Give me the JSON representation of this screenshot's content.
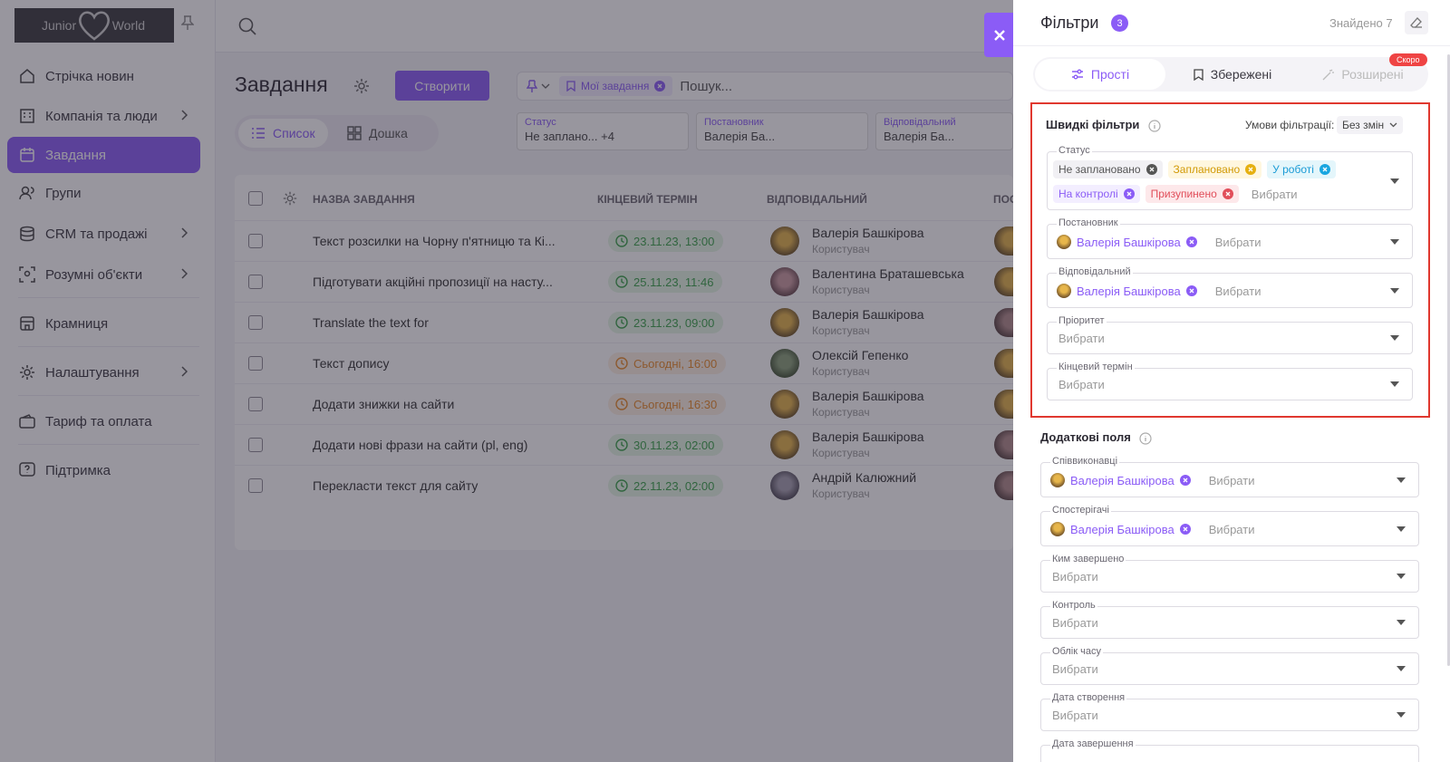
{
  "app": {
    "logo": {
      "left": "Junior",
      "right": "World"
    },
    "sidebar": [
      {
        "label": "Стрічка новин",
        "icon": "home-icon",
        "chevron": false,
        "active": false
      },
      {
        "label": "Компанія та люди",
        "icon": "building-icon",
        "chevron": true,
        "active": false
      },
      {
        "label": "Завдання",
        "icon": "calendar-icon",
        "chevron": false,
        "active": true
      },
      {
        "label": "Групи",
        "icon": "users-icon",
        "chevron": false,
        "active": false
      },
      {
        "label": "CRM та продажі",
        "icon": "database-icon",
        "chevron": true,
        "active": false
      },
      {
        "label": "Розумні об'єкти",
        "icon": "scan-icon",
        "chevron": true,
        "active": false
      },
      {
        "label": "Крамниця",
        "icon": "store-icon",
        "chevron": false,
        "active": false
      },
      {
        "label": "Налаштування",
        "icon": "gear-icon",
        "chevron": true,
        "active": false
      },
      {
        "label": "Тариф та оплата",
        "icon": "wallet-icon",
        "chevron": false,
        "active": false
      },
      {
        "label": "Підтримка",
        "icon": "help-icon",
        "chevron": false,
        "active": false
      }
    ]
  },
  "main": {
    "title": "Завдання",
    "create_label": "Створити",
    "my_tasks_chip": "Мої завдання",
    "search_placeholder": "Пошук...",
    "views": {
      "list": "Список",
      "board": "Дошка"
    },
    "filter_boxes": [
      {
        "label": "Статус",
        "value": "Не заплано...  +4"
      },
      {
        "label": "Постановник",
        "value": "Валерія Ба..."
      },
      {
        "label": "Відповідальний",
        "value": "Валерія Ба..."
      }
    ],
    "columns": [
      "НАЗВА ЗАВДАННЯ",
      "КІНЦЕВИЙ ТЕРМІН",
      "ВІДПОВІДАЛЬНИЙ",
      "ПОС"
    ],
    "rows": [
      {
        "name": "Текст розсилки на Чорну п'ятницю та Кі...",
        "date": "23.11.23, 13:00",
        "status": "green",
        "user": "Валерія Башкірова",
        "role": "Користувач"
      },
      {
        "name": "Підготувати акційні пропозиції на насту...",
        "date": "25.11.23, 11:46",
        "status": "green",
        "user": "Валентина Браташевська",
        "role": "Користувач"
      },
      {
        "name": "Translate the text for",
        "date": "23.11.23, 09:00",
        "status": "green",
        "user": "Валерія Башкірова",
        "role": "Користувач"
      },
      {
        "name": "Текст допису",
        "date": "Сьогодні, 16:00",
        "status": "orange",
        "user": "Олексій Гепенко",
        "role": "Користувач"
      },
      {
        "name": "Додати знижки на сайти",
        "date": "Сьогодні, 16:30",
        "status": "orange",
        "user": "Валерія Башкірова",
        "role": "Користувач"
      },
      {
        "name": "Додати нові фрази на сайти (pl, eng)",
        "date": "30.11.23, 02:00",
        "status": "green",
        "user": "Валерія Башкірова",
        "role": "Користувач"
      },
      {
        "name": "Перекласти текст для сайту",
        "date": "22.11.23, 02:00",
        "status": "green",
        "user": "Андрій Калюжний",
        "role": "Користувач"
      }
    ]
  },
  "panel": {
    "title": "Фільтри",
    "count": "3",
    "found": "Знайдено 7",
    "tabs": {
      "simple": "Прості",
      "saved": "Збережені",
      "advanced": "Розширені"
    },
    "soon": "Скоро",
    "quick": {
      "title": "Швидкі фільтри",
      "cond_label": "Умови фільтрації:",
      "cond_value": "Без змін",
      "status_label": "Статус",
      "status_tags": [
        {
          "label": "Не заплановано",
          "color": "grey"
        },
        {
          "label": "Заплановано",
          "color": "yellow"
        },
        {
          "label": "У роботі",
          "color": "blue"
        },
        {
          "label": "На контролі",
          "color": "purple"
        },
        {
          "label": "Призупинено",
          "color": "red"
        }
      ],
      "placeholder": "Вибрати",
      "author_label": "Постановник",
      "author_value": "Валерія Башкірова",
      "resp_label": "Відповідальний",
      "resp_value": "Валерія Башкірова",
      "priority_label": "Пріоритет",
      "deadline_label": "Кінцевий термін"
    },
    "extra": {
      "title": "Додаткові поля",
      "coexec_label": "Співвиконавці",
      "coexec_value": "Валерія Башкірова",
      "observers_label": "Спостерігачі",
      "observers_value": "Валерія Башкірова",
      "completed_by_label": "Ким завершено",
      "control_label": "Контроль",
      "time_label": "Облік часу",
      "created_label": "Дата створення",
      "finished_label": "Дата завершення"
    }
  }
}
